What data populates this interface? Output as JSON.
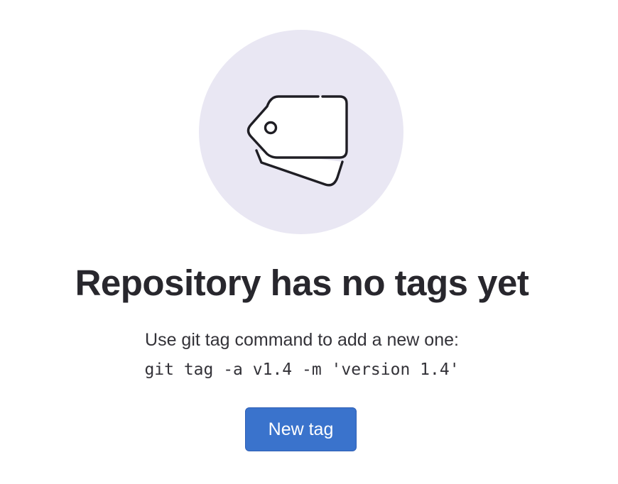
{
  "empty_state": {
    "illustration_icon": "tag-icon",
    "title": "Repository has no tags yet",
    "description": "Use git tag command to add a new one:",
    "command": "git tag -a v1.4 -m 'version 1.4'",
    "new_tag_label": "New tag"
  },
  "colors": {
    "illustration_bg": "#e9e7f3",
    "title_text": "#28272d",
    "button_bg": "#3a73cc",
    "button_text": "#ffffff"
  }
}
